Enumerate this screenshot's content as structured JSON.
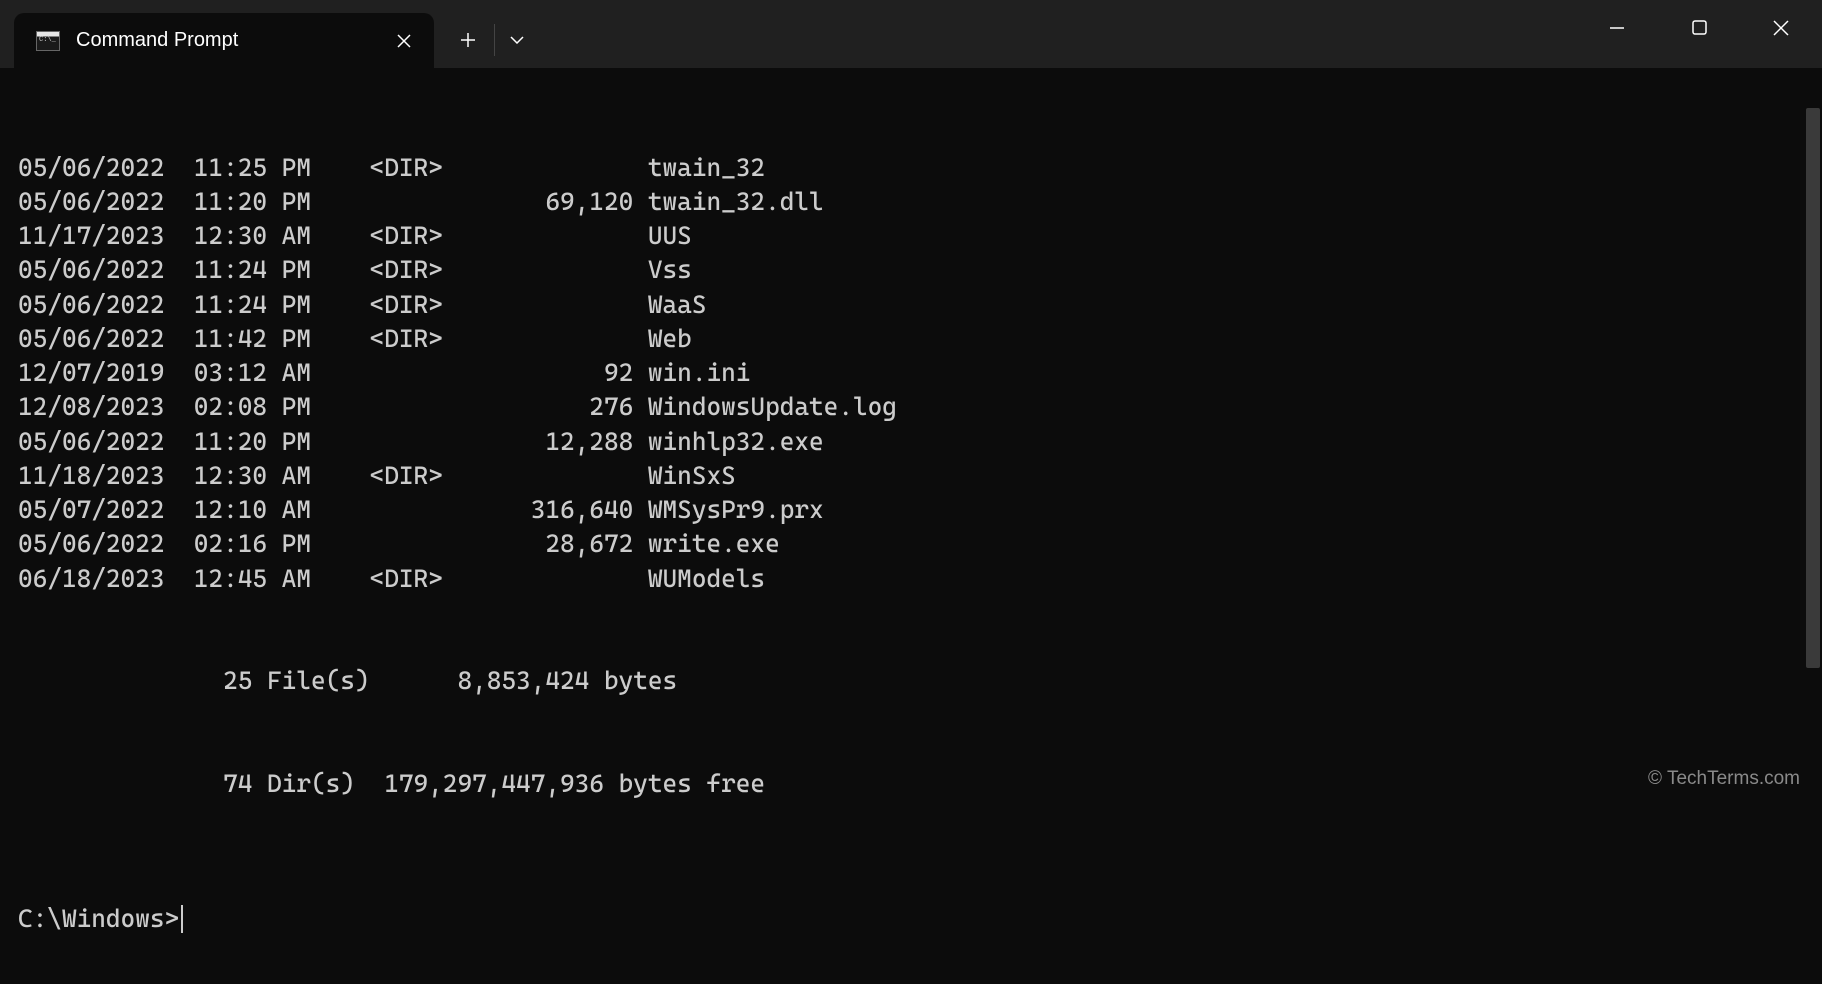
{
  "window": {
    "tab_title": "Command Prompt"
  },
  "listing": {
    "rows": [
      {
        "date": "05/06/2022",
        "time": "11:25 PM",
        "dir": "<DIR>",
        "size": "",
        "name": "twain_32"
      },
      {
        "date": "05/06/2022",
        "time": "11:20 PM",
        "dir": "",
        "size": "69,120",
        "name": "twain_32.dll"
      },
      {
        "date": "11/17/2023",
        "time": "12:30 AM",
        "dir": "<DIR>",
        "size": "",
        "name": "UUS"
      },
      {
        "date": "05/06/2022",
        "time": "11:24 PM",
        "dir": "<DIR>",
        "size": "",
        "name": "Vss"
      },
      {
        "date": "05/06/2022",
        "time": "11:24 PM",
        "dir": "<DIR>",
        "size": "",
        "name": "WaaS"
      },
      {
        "date": "05/06/2022",
        "time": "11:42 PM",
        "dir": "<DIR>",
        "size": "",
        "name": "Web"
      },
      {
        "date": "12/07/2019",
        "time": "03:12 AM",
        "dir": "",
        "size": "92",
        "name": "win.ini"
      },
      {
        "date": "12/08/2023",
        "time": "02:08 PM",
        "dir": "",
        "size": "276",
        "name": "WindowsUpdate.log"
      },
      {
        "date": "05/06/2022",
        "time": "11:20 PM",
        "dir": "",
        "size": "12,288",
        "name": "winhlp32.exe"
      },
      {
        "date": "11/18/2023",
        "time": "12:30 AM",
        "dir": "<DIR>",
        "size": "",
        "name": "WinSxS"
      },
      {
        "date": "05/07/2022",
        "time": "12:10 AM",
        "dir": "",
        "size": "316,640",
        "name": "WMSysPr9.prx"
      },
      {
        "date": "05/06/2022",
        "time": "02:16 PM",
        "dir": "",
        "size": "28,672",
        "name": "write.exe"
      },
      {
        "date": "06/18/2023",
        "time": "12:45 AM",
        "dir": "<DIR>",
        "size": "",
        "name": "WUModels"
      }
    ],
    "summary": {
      "files_line": "              25 File(s)      8,853,424 bytes",
      "dirs_line": "              74 Dir(s)  179,297,447,936 bytes free"
    }
  },
  "prompt": "C:\\Windows>",
  "watermark": "© TechTerms.com"
}
